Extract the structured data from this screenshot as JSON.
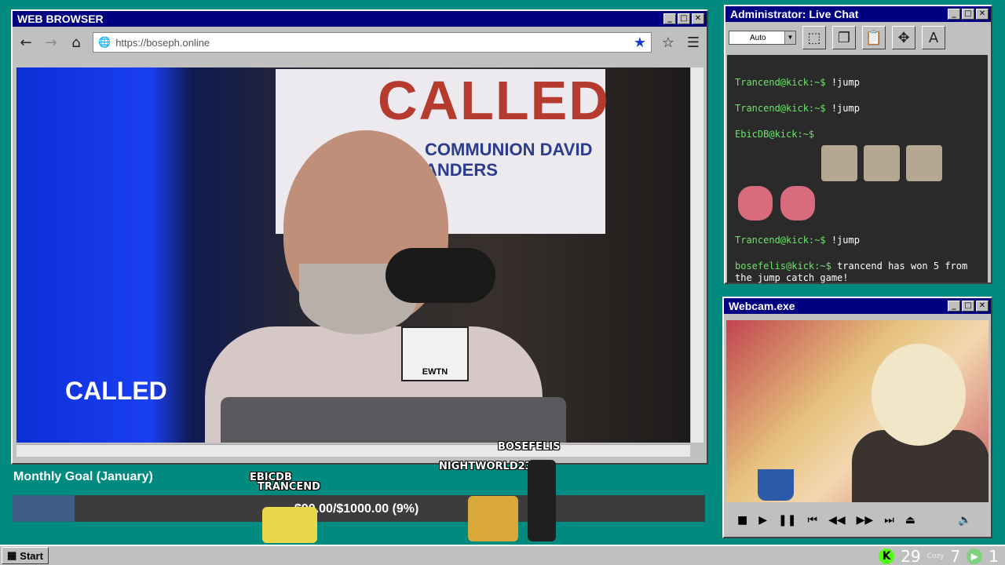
{
  "browser": {
    "title": "WEB BROWSER",
    "url": "https://boseph.online",
    "controls": {
      "minimize": "_",
      "maximize": "□",
      "close": "✕"
    },
    "nav": {
      "back": "←",
      "forward": "→",
      "home": "⌂"
    }
  },
  "video": {
    "sign_text": "CALLED",
    "sign_subtext": "COMMUNION  DAVID ANDERS",
    "badge_text": "CALLED",
    "mic_flag": "EWTN"
  },
  "chat": {
    "title": "Administrator: Live Chat",
    "auto_select": "Auto",
    "messages": [
      {
        "user": "Trancend@kick:~$",
        "text": "!jump"
      },
      {
        "user": "Trancend@kick:~$",
        "text": "!jump"
      },
      {
        "user": "EbicDB@kick:~$",
        "text": ""
      },
      {
        "user": "Trancend@kick:~$",
        "text": "!jump"
      },
      {
        "user": "bosefelis@kick:~$",
        "text": "trancend has won 5 from the jump catch game!"
      }
    ]
  },
  "webcam": {
    "title": "Webcam.exe"
  },
  "goal": {
    "title": "Monthly Goal (January)",
    "progress_text": "$90.00/$1000.00 (9%)",
    "progress": 0.09
  },
  "players": [
    "BOSEFELIS",
    "NIGHTWORLD23",
    "EBICDB",
    "TRANCEND"
  ],
  "taskbar": {
    "start_label": "Start",
    "kick_count": "29",
    "cozy_count": "7",
    "cozy_label": "Cozy",
    "other_count": "1"
  },
  "colors": {
    "kick": "#53fc18",
    "chat_user": "#6fe36a",
    "titlebar": "#000080"
  }
}
